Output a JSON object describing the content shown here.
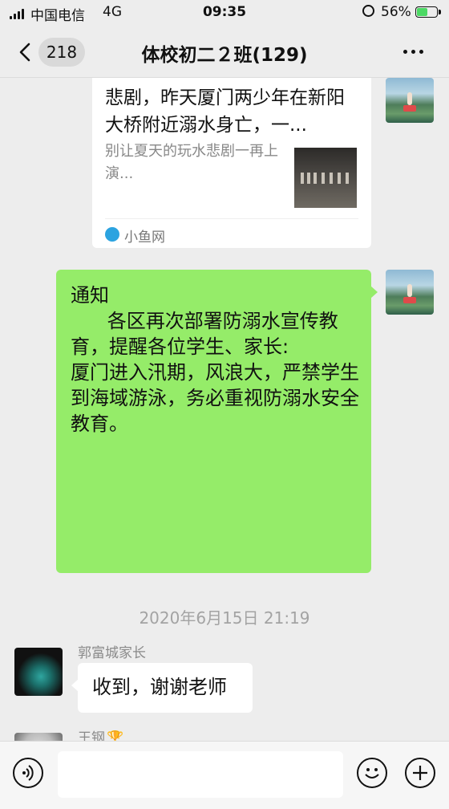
{
  "status_bar": {
    "carrier": "中国电信",
    "network": "4G",
    "time": "09:35",
    "battery_percent": "56%",
    "battery_level": 0.56
  },
  "nav": {
    "unread_count": "218",
    "title": "体校初二２班(129)"
  },
  "messages": {
    "shared_article": {
      "title": "悲剧，昨天厦门两少年在新阳大桥附近溺水身亡，一...",
      "description": "别让夏天的玩水悲剧一再上演...",
      "source": "小鱼网"
    },
    "notice": {
      "text": "通知\n      各区再次部署防溺水宣传教育，提醒各位学生、家长:\n厦门进入汛期，风浪大，严禁学生到海域游泳，务必重视防溺水安全教育。"
    },
    "timestamp": "2020年6月15日 21:19",
    "reply": {
      "sender": "郭富城家长",
      "text": "收到，谢谢老师"
    },
    "next_sender": {
      "name": "王钢"
    }
  },
  "colors": {
    "my_bubble": "#95ec69",
    "background": "#ededed"
  },
  "icons": {
    "trophy": "🏆"
  }
}
